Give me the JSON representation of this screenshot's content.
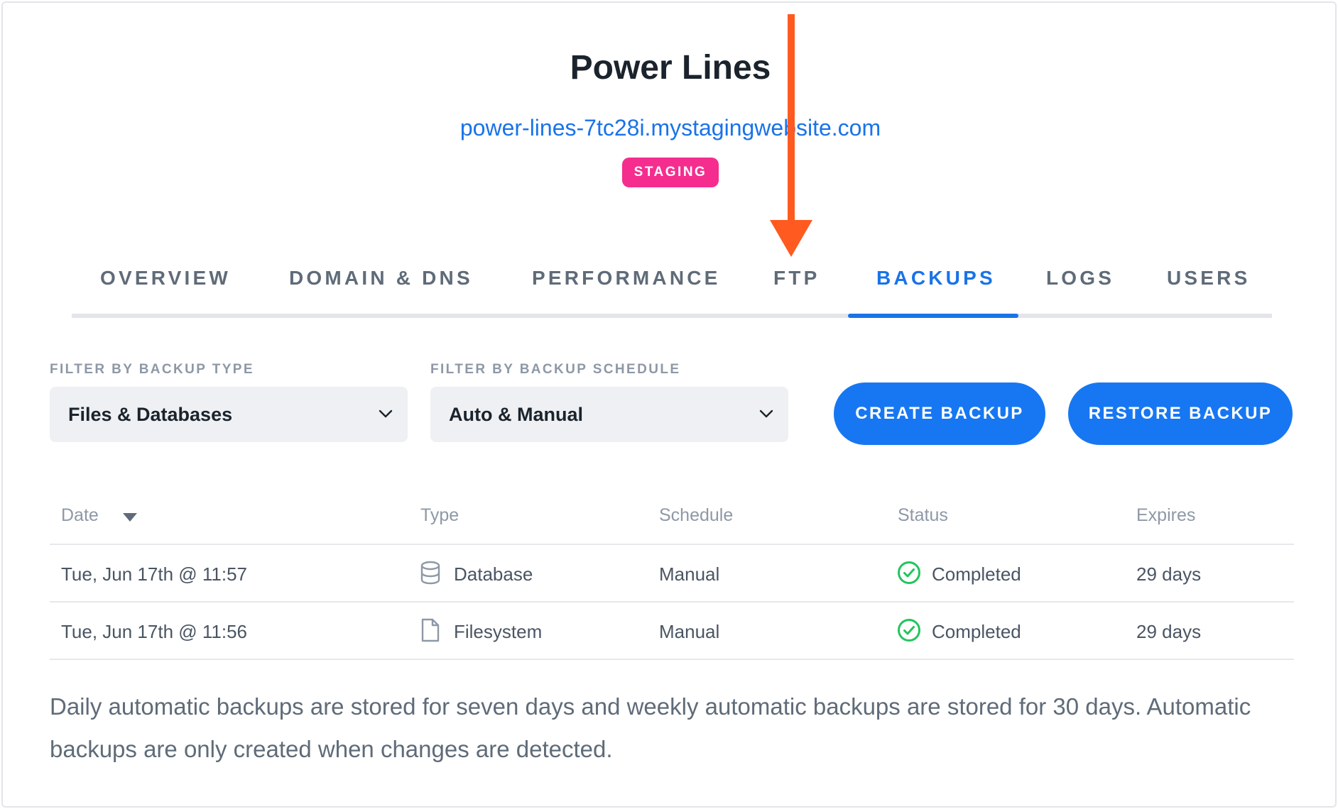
{
  "site": {
    "title": "Power Lines",
    "url": "power-lines-7tc28i.mystagingwebsite.com",
    "badge": "STAGING"
  },
  "tabs": [
    {
      "label": "OVERVIEW",
      "active": false
    },
    {
      "label": "DOMAIN & DNS",
      "active": false
    },
    {
      "label": "PERFORMANCE",
      "active": false
    },
    {
      "label": "FTP",
      "active": false
    },
    {
      "label": "BACKUPS",
      "active": true
    },
    {
      "label": "LOGS",
      "active": false
    },
    {
      "label": "USERS",
      "active": false
    }
  ],
  "filters": {
    "type": {
      "label": "FILTER BY BACKUP TYPE",
      "value": "Files & Databases"
    },
    "schedule": {
      "label": "FILTER BY BACKUP SCHEDULE",
      "value": "Auto & Manual"
    }
  },
  "actions": {
    "create": "CREATE BACKUP",
    "restore": "RESTORE BACKUP"
  },
  "table": {
    "headers": [
      "Date",
      "Type",
      "Schedule",
      "Status",
      "Expires"
    ],
    "rows": [
      {
        "date": "Tue, Jun 17th @ 11:57",
        "type": "Database",
        "type_icon": "database-icon",
        "schedule": "Manual",
        "status": "Completed",
        "expires": "29 days"
      },
      {
        "date": "Tue, Jun 17th @ 11:56",
        "type": "Filesystem",
        "type_icon": "file-icon",
        "schedule": "Manual",
        "status": "Completed",
        "expires": "29 days"
      }
    ]
  },
  "note": "Daily automatic backups are stored for seven days and weekly automatic backups are stored for 30 days. Automatic backups are only created when changes are detected.",
  "colors": {
    "accent": "#1777f2",
    "badge": "#f52d8e",
    "success": "#22c55e",
    "annotation_arrow": "#ff5a1f"
  }
}
